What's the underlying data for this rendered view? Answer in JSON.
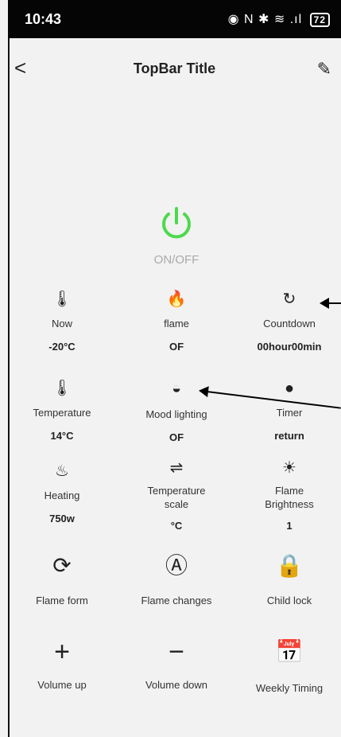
{
  "status_bar": {
    "time": "10:43",
    "icons": "◉ N ✱ ≋ .ıl",
    "battery": "72"
  },
  "topbar": {
    "back": "<",
    "title": "TopBar Title",
    "edit": "✎"
  },
  "power": {
    "label": "ON/OFF",
    "icon": "power-icon",
    "color": "#4cd94c"
  },
  "items": [
    {
      "label": "Now",
      "value": "-20°C",
      "icon": "thermometer-icon",
      "glyph": "🌡"
    },
    {
      "label": "flame",
      "value": "OF",
      "icon": "flame-icon",
      "glyph": "🔥"
    },
    {
      "label": "Countdown",
      "value": "00hour00min",
      "icon": "countdown-icon",
      "glyph": "↻"
    },
    {
      "label": "Temperature",
      "value": "14°C",
      "icon": "temperature-icon",
      "glyph": "🌡"
    },
    {
      "label": "Mood lighting",
      "value": "OF",
      "icon": "mood-light-icon",
      "glyph": "◒"
    },
    {
      "label": "Timer",
      "value": "return",
      "icon": "timer-icon",
      "glyph": "●"
    },
    {
      "label": "Heating",
      "value": "750w",
      "icon": "heating-icon",
      "glyph": "♨"
    },
    {
      "label": "Temperature\nscale",
      "value": "°C",
      "icon": "slider-icon",
      "glyph": "⇌"
    },
    {
      "label": "Flame\nBrightness",
      "value": "1",
      "icon": "brightness-icon",
      "glyph": "☀"
    },
    {
      "label": "Flame form",
      "icon": "flame-form-icon",
      "glyph": "⟳"
    },
    {
      "label": "Flame changes",
      "icon": "flame-changes-icon",
      "glyph": "Ⓐ"
    },
    {
      "label": "Child lock",
      "icon": "lock-icon",
      "glyph": "🔒"
    },
    {
      "label": "Volume up",
      "icon": "plus-icon",
      "glyph": "+"
    },
    {
      "label": "Volume down",
      "icon": "minus-icon",
      "glyph": "−"
    },
    {
      "label": "Weekly Timing",
      "icon": "calendar-icon",
      "glyph": "📅"
    }
  ],
  "colors": {
    "background": "#f2f2f2",
    "power": "#4cd94c"
  }
}
